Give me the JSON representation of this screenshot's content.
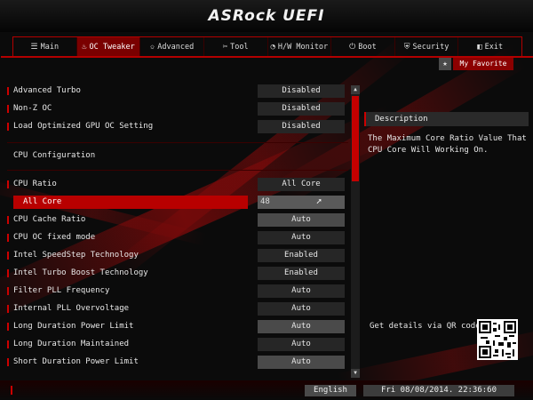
{
  "header": {
    "title": "ASRock UEFI"
  },
  "tabs": [
    {
      "icon": "menu-icon",
      "glyph": "☰",
      "label": "Main"
    },
    {
      "icon": "flame-icon",
      "glyph": "♨",
      "label": "OC Tweaker"
    },
    {
      "icon": "star-icon",
      "glyph": "✩",
      "label": "Advanced"
    },
    {
      "icon": "tool-icon",
      "glyph": "✂",
      "label": "Tool"
    },
    {
      "icon": "monitor-icon",
      "glyph": "◔",
      "label": "H/W Monitor"
    },
    {
      "icon": "power-icon",
      "glyph": "⏻",
      "label": "Boot"
    },
    {
      "icon": "shield-icon",
      "glyph": "⛨",
      "label": "Security"
    },
    {
      "icon": "exit-icon",
      "glyph": "◧",
      "label": "Exit"
    }
  ],
  "active_tab": "OC Tweaker",
  "favorite": {
    "label": "My Favorite"
  },
  "settings": [
    {
      "label": "Advanced Turbo",
      "value": "Disabled"
    },
    {
      "label": "Non-Z OC",
      "value": "Disabled"
    },
    {
      "label": "Load Optimized GPU OC Setting",
      "value": "Disabled"
    }
  ],
  "section_title": "CPU Configuration",
  "cpu_settings": [
    {
      "label": "CPU Ratio",
      "value": "All Core"
    },
    {
      "label": "All Core",
      "value": "48",
      "selected": true
    },
    {
      "label": "CPU Cache Ratio",
      "value": "Auto"
    },
    {
      "label": "CPU OC fixed mode",
      "value": "Auto"
    },
    {
      "label": "Intel SpeedStep Technology",
      "value": "Enabled"
    },
    {
      "label": "Intel Turbo Boost Technology",
      "value": "Enabled"
    },
    {
      "label": "Filter PLL Frequency",
      "value": "Auto"
    },
    {
      "label": "Internal PLL Overvoltage",
      "value": "Auto"
    },
    {
      "label": "Long Duration Power Limit",
      "value": "Auto"
    },
    {
      "label": "Long Duration Maintained",
      "value": "Auto"
    },
    {
      "label": "Short Duration Power Limit",
      "value": "Auto"
    }
  ],
  "description": {
    "heading": "Description",
    "text": "The Maximum Core Ratio Value That CPU Core Will Working On."
  },
  "qr_label": "Get details via QR code",
  "footer": {
    "language": "English",
    "datetime": "Fri 08/08/2014. 22:36:60"
  },
  "colors": {
    "accent": "#cc0000",
    "active_tab": "#7a0000",
    "background": "#0b0b0b"
  }
}
